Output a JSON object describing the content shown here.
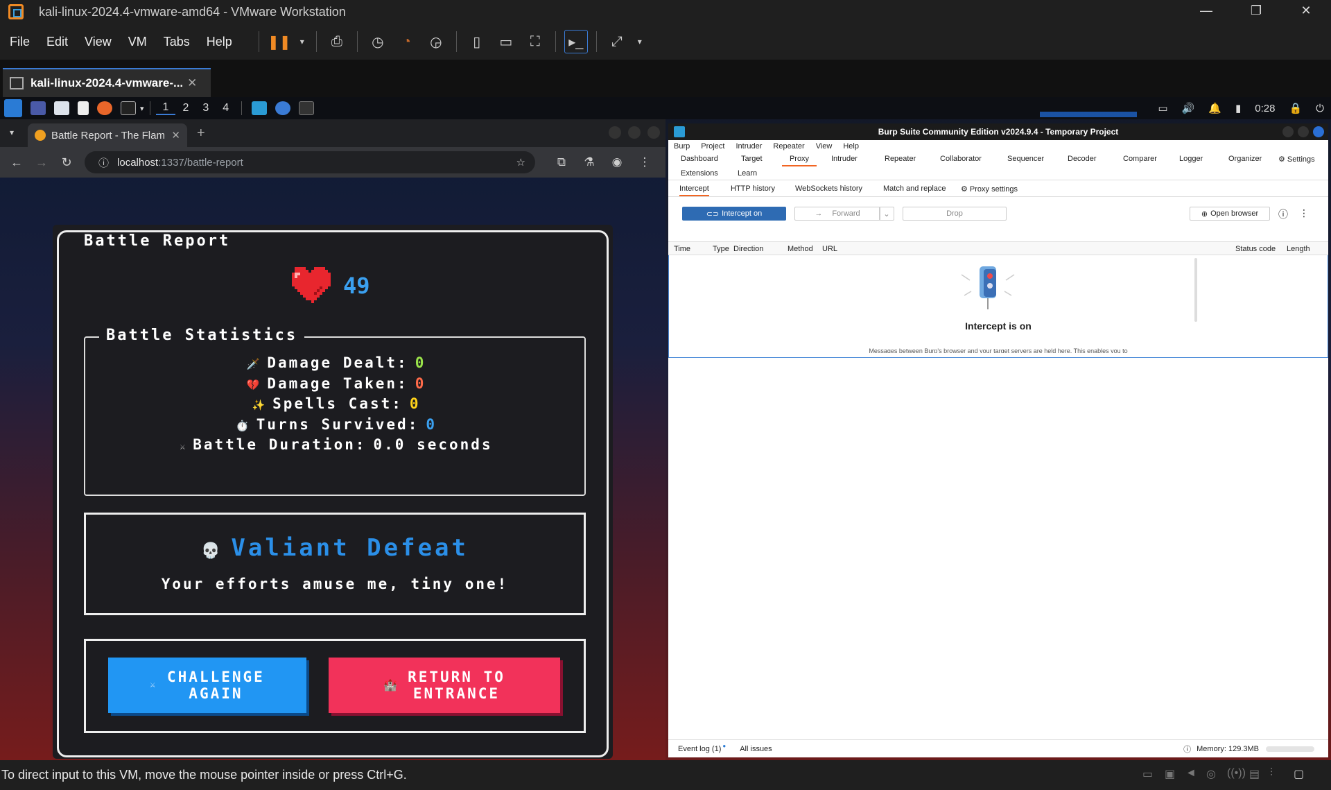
{
  "vmware": {
    "title": "kali-linux-2024.4-vmware-amd64 - VMware Workstation",
    "menu": [
      "File",
      "Edit",
      "View",
      "VM",
      "Tabs",
      "Help"
    ],
    "vm_tab": "kali-linux-2024.4-vmware-...",
    "status": "To direct input to this VM, move the mouse pointer inside or press Ctrl+G."
  },
  "kali_panel": {
    "workspaces": [
      "1",
      "2",
      "3",
      "4"
    ],
    "time": "0:28"
  },
  "browser": {
    "tab_title": "Battle Report - The Flam",
    "url_host": "localhost",
    "url_path": ":1337/battle-report"
  },
  "report": {
    "title": "Battle Report",
    "hp": "49",
    "stats_legend": "Battle Statistics",
    "stats": [
      {
        "icon": "🗡️",
        "label": "Damage Dealt:",
        "value": "0",
        "color": "#9ae34a"
      },
      {
        "icon": "💔",
        "label": "Damage Taken:",
        "value": "0",
        "color": "#ff6b4a"
      },
      {
        "icon": "✨",
        "label": "Spells Cast:",
        "value": "0",
        "color": "#ffd21a"
      },
      {
        "icon": "⏱️",
        "label": "Turns Survived:",
        "value": "0",
        "color": "#3ba0f0"
      },
      {
        "icon": "⚔",
        "label": "Battle Duration:",
        "value": "0.0 seconds",
        "color": "#ffffff"
      }
    ],
    "defeat_icon": "💀",
    "defeat_title": "Valiant Defeat",
    "defeat_sub": "Your efforts amuse me, tiny one!",
    "btn_again_icon": "⚔",
    "btn_again_1": "CHALLENGE",
    "btn_again_2": "AGAIN",
    "btn_return_icon": "🏰",
    "btn_return_1": "RETURN TO",
    "btn_return_2": "ENTRANCE"
  },
  "burp": {
    "title": "Burp Suite Community Edition v2024.9.4 - Temporary Project",
    "menu": [
      "Burp",
      "Project",
      "Intruder",
      "Repeater",
      "View",
      "Help"
    ],
    "tabs_row1": [
      "Dashboard",
      "Target",
      "Proxy",
      "Intruder",
      "Repeater",
      "Collaborator",
      "Sequencer",
      "Decoder",
      "Comparer",
      "Logger",
      "Organizer",
      "Settings"
    ],
    "tabs_row2": [
      "Extensions",
      "Learn"
    ],
    "subtabs": [
      "Intercept",
      "HTTP history",
      "WebSockets history",
      "Match and replace",
      "Proxy settings"
    ],
    "intercept_btn": "Intercept on",
    "forward_btn": "Forward",
    "drop_btn": "Drop",
    "open_browser": "Open browser",
    "columns": [
      "Time",
      "Type",
      "Direction",
      "Method",
      "URL",
      "Status code",
      "Length"
    ],
    "intercept_state": "Intercept is on",
    "message": "Messages between Burp's browser and your target servers are held here. This enables you to",
    "event_log": "Event log (1)",
    "all_issues": "All issues",
    "memory": "Memory: 129.3MB"
  }
}
